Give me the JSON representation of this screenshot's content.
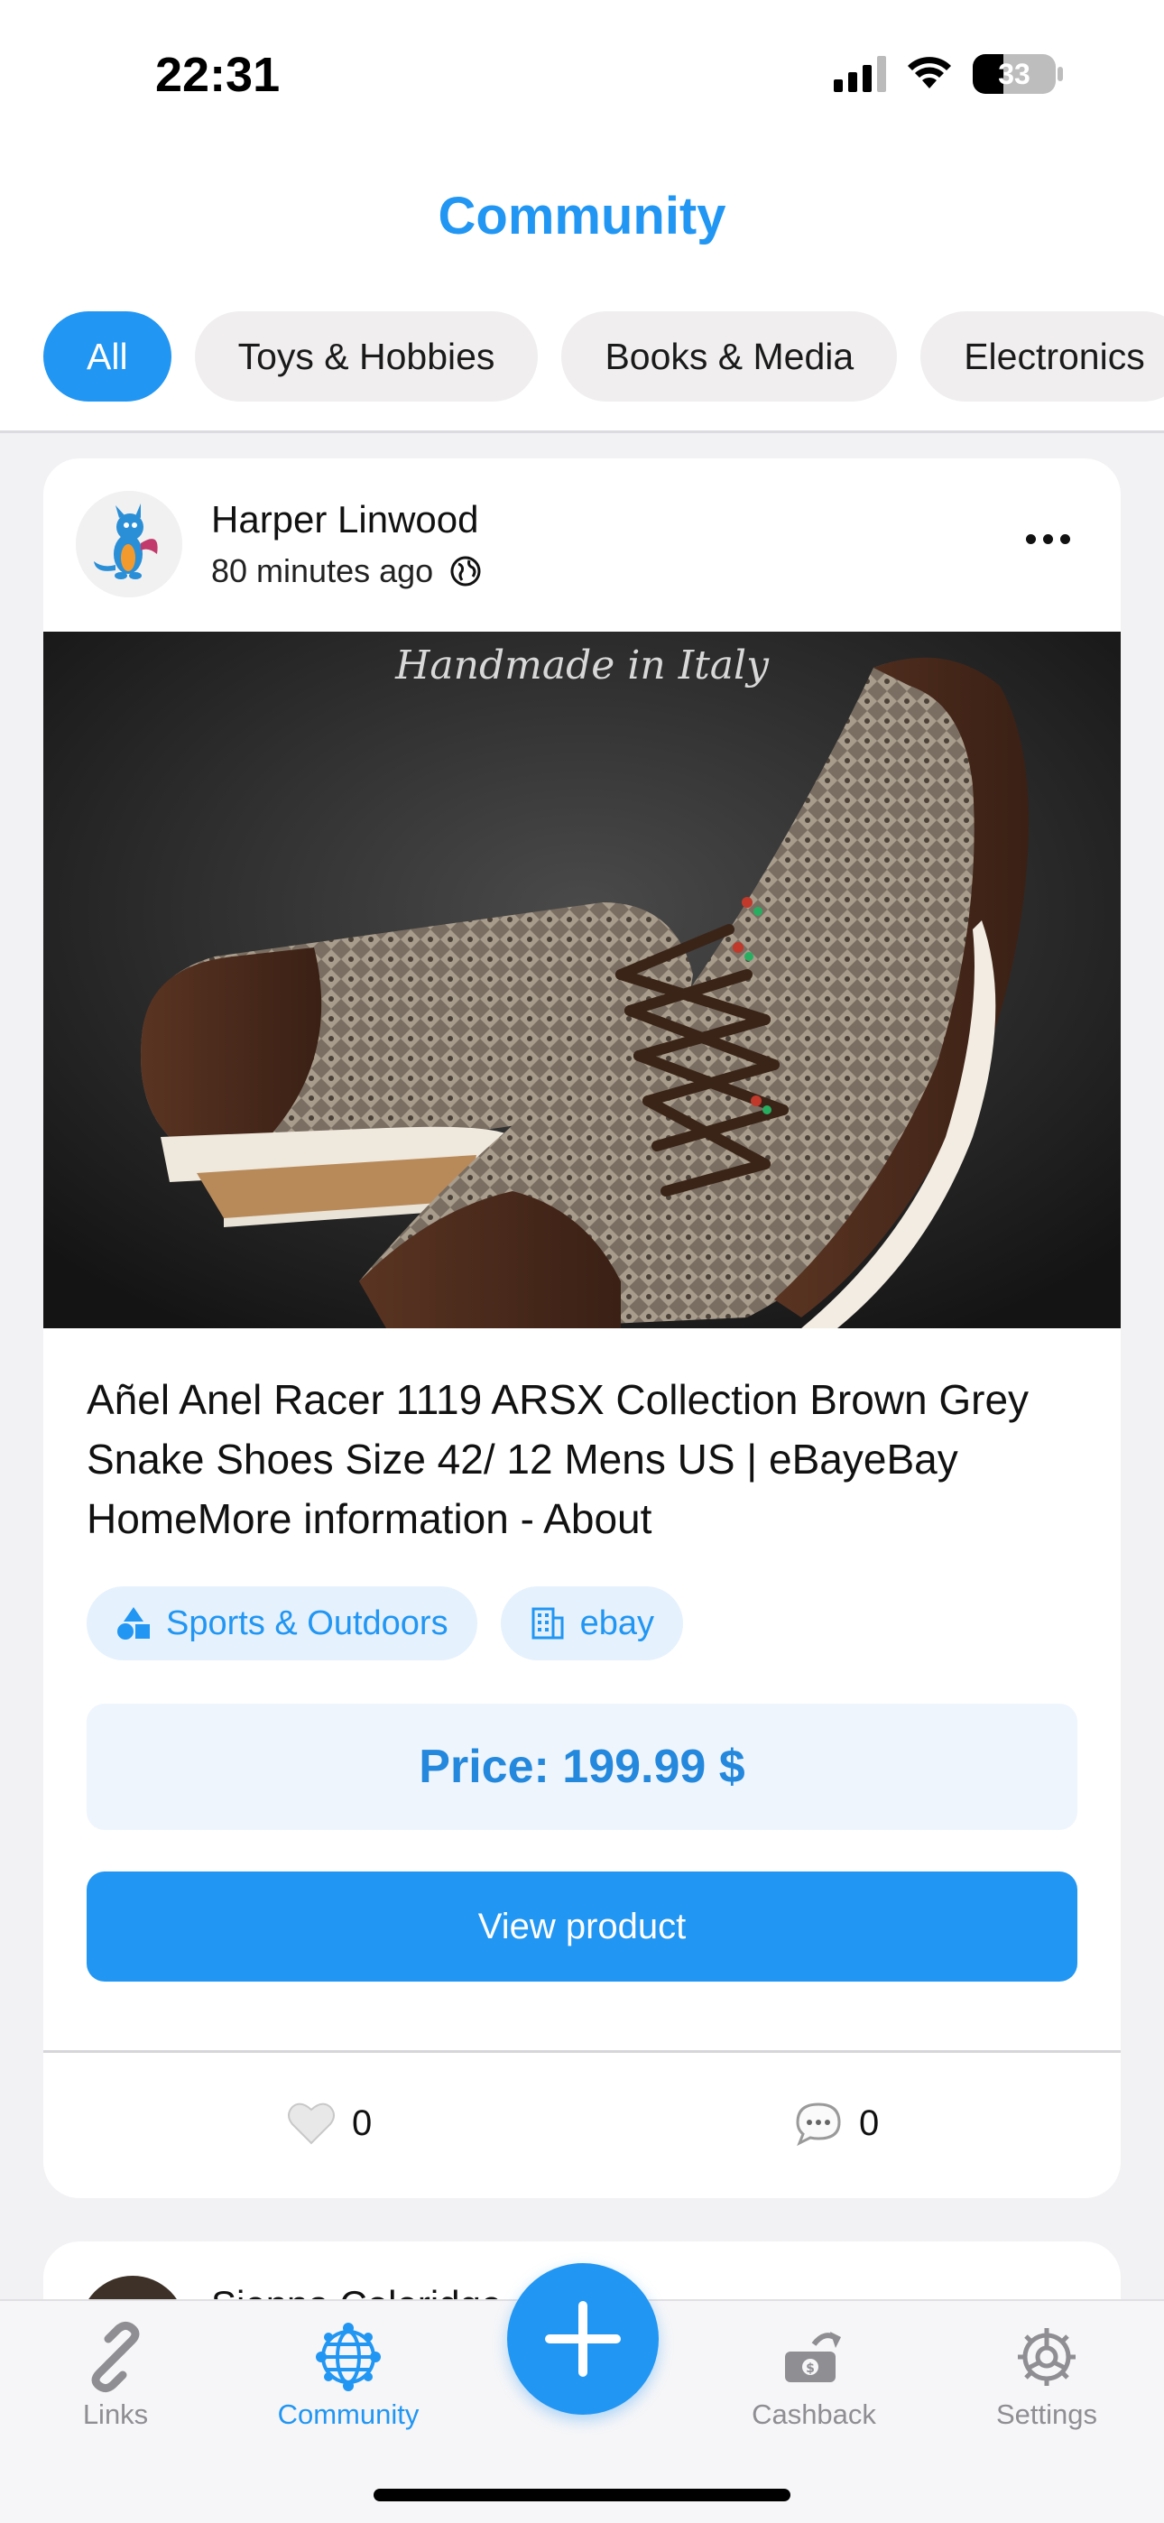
{
  "status_bar": {
    "time": "22:31",
    "battery": "33"
  },
  "header": {
    "title": "Community",
    "filters": [
      "All",
      "Toys & Hobbies",
      "Books & Media",
      "Electronics"
    ],
    "active_filter_index": 0
  },
  "post": {
    "author": "Harper Linwood",
    "time": "80 minutes ago",
    "image_caption": "Handmade in Italy",
    "title": "Añel Anel Racer 1119 ARSX Collection Brown Grey Snake Shoes Size 42/ 12 Mens US | eBayeBay HomeMore information - About",
    "tags": [
      {
        "label": "Sports & Outdoors",
        "icon": "shapes-icon"
      },
      {
        "label": "ebay",
        "icon": "building-icon"
      }
    ],
    "price": "Price: 199.99 $",
    "button_label": "View product",
    "likes": "0",
    "comments": "0"
  },
  "next_post": {
    "author": "Sienna Coleridge"
  },
  "nav": {
    "items": [
      {
        "label": "Links",
        "icon": "link-icon"
      },
      {
        "label": "Community",
        "icon": "globe-network-icon"
      },
      {
        "label": "Cashback",
        "icon": "cashback-icon"
      },
      {
        "label": "Settings",
        "icon": "gear-icon"
      }
    ],
    "active_index": 1
  },
  "colors": {
    "accent": "#2196f3",
    "tag_bg": "#e5f1fd",
    "price_bg": "#eef5fd"
  }
}
